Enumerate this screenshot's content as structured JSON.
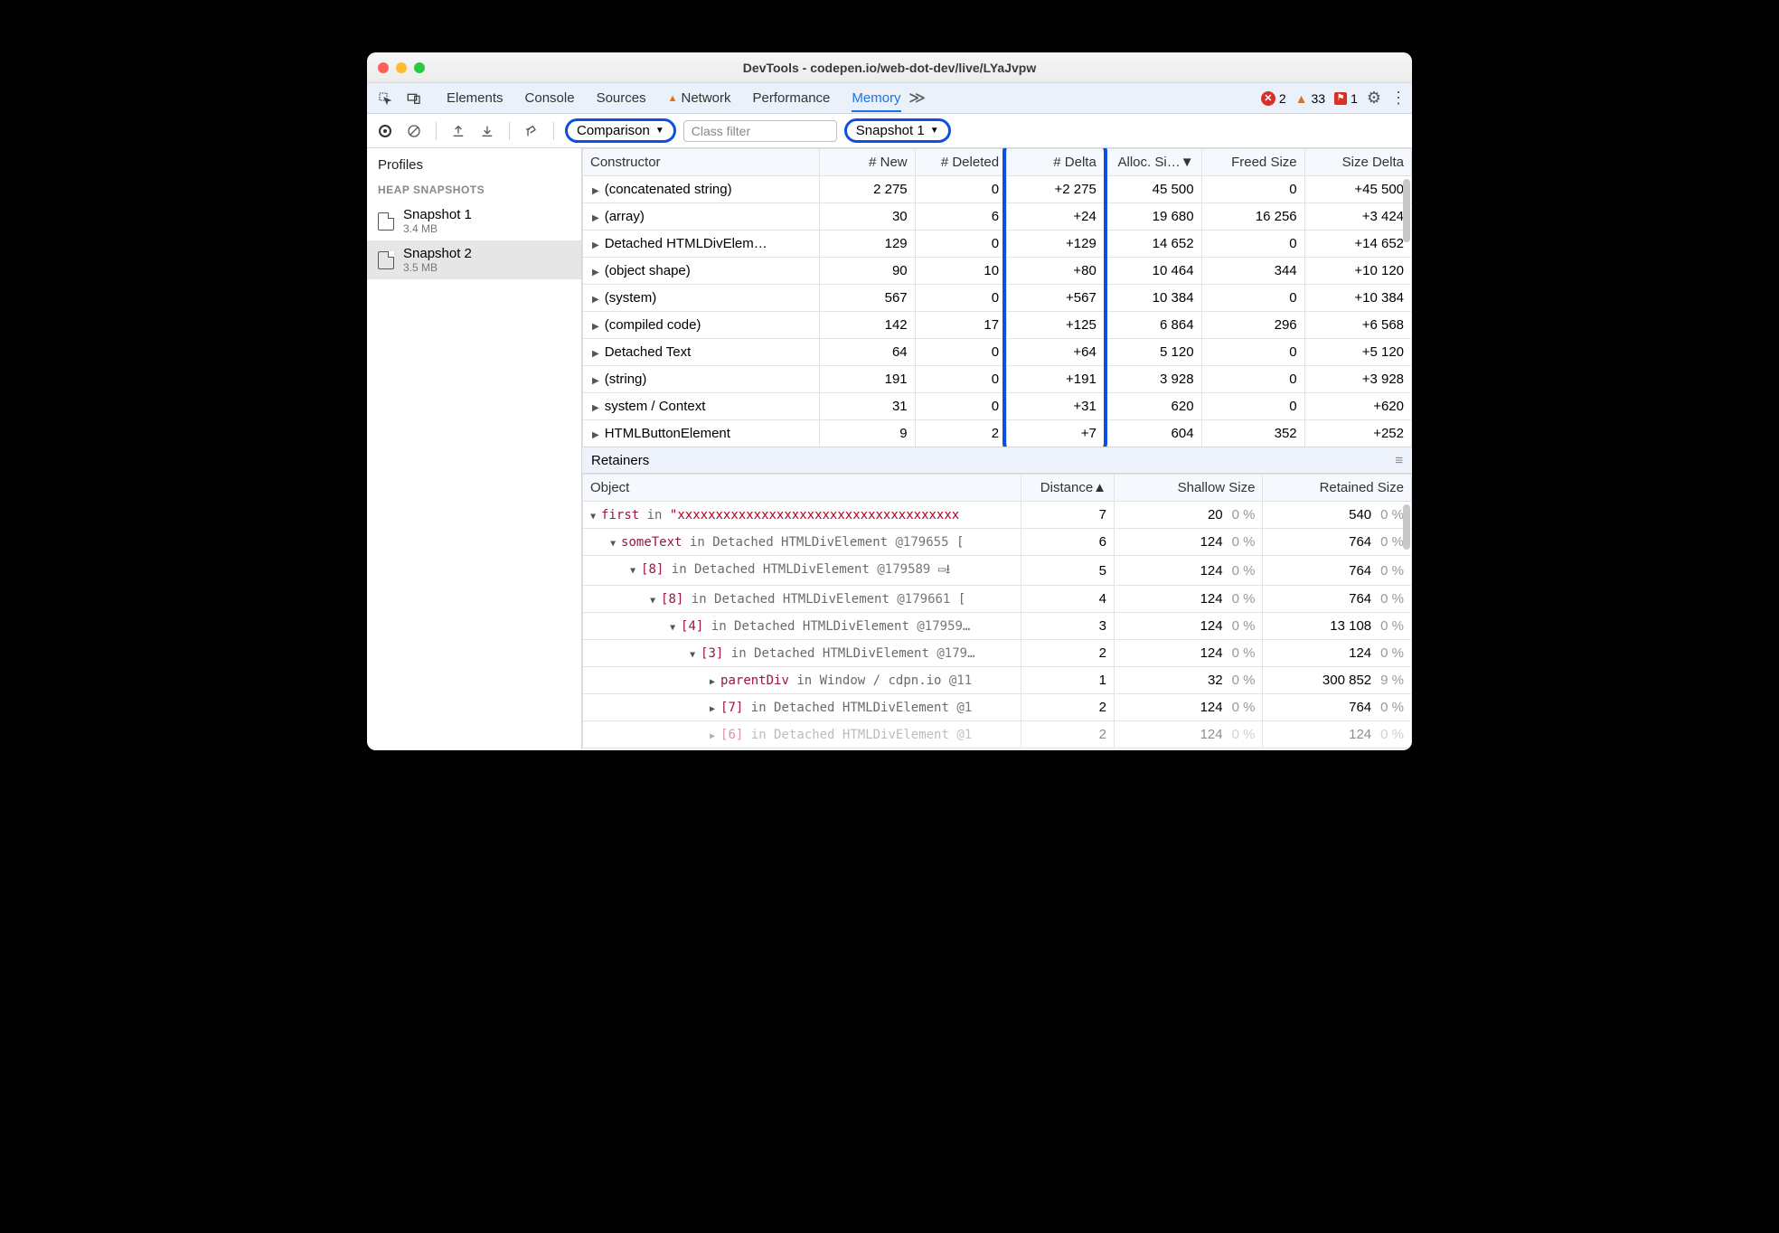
{
  "window": {
    "title": "DevTools - codepen.io/web-dot-dev/live/LYaJvpw"
  },
  "tabs": {
    "items": [
      "Elements",
      "Console",
      "Sources",
      "Network",
      "Performance",
      "Memory"
    ],
    "more": "≫",
    "active": "Memory",
    "warn_tab": "Network"
  },
  "status": {
    "errors": "2",
    "warnings": "33",
    "issues": "1"
  },
  "toolbar": {
    "view_mode": "Comparison",
    "filter_placeholder": "Class filter",
    "baseline": "Snapshot 1"
  },
  "sidebar": {
    "heading": "Profiles",
    "section": "HEAP SNAPSHOTS",
    "snapshots": [
      {
        "name": "Snapshot 1",
        "size": "3.4 MB",
        "selected": false
      },
      {
        "name": "Snapshot 2",
        "size": "3.5 MB",
        "selected": true
      }
    ]
  },
  "grid": {
    "headers": [
      "Constructor",
      "# New",
      "# Deleted",
      "# Delta",
      "Alloc. Si…",
      "Freed Size",
      "Size Delta"
    ],
    "alloc_sorted": true,
    "rows": [
      {
        "c": "(concatenated string)",
        "n": "2 275",
        "d": "0",
        "dl": "+2 275",
        "a": "45 500",
        "f": "0",
        "s": "+45 500"
      },
      {
        "c": "(array)",
        "n": "30",
        "d": "6",
        "dl": "+24",
        "a": "19 680",
        "f": "16 256",
        "s": "+3 424"
      },
      {
        "c": "Detached HTMLDivElem…",
        "n": "129",
        "d": "0",
        "dl": "+129",
        "a": "14 652",
        "f": "0",
        "s": "+14 652"
      },
      {
        "c": "(object shape)",
        "n": "90",
        "d": "10",
        "dl": "+80",
        "a": "10 464",
        "f": "344",
        "s": "+10 120"
      },
      {
        "c": "(system)",
        "n": "567",
        "d": "0",
        "dl": "+567",
        "a": "10 384",
        "f": "0",
        "s": "+10 384"
      },
      {
        "c": "(compiled code)",
        "n": "142",
        "d": "17",
        "dl": "+125",
        "a": "6 864",
        "f": "296",
        "s": "+6 568"
      },
      {
        "c": "Detached Text",
        "n": "64",
        "d": "0",
        "dl": "+64",
        "a": "5 120",
        "f": "0",
        "s": "+5 120"
      },
      {
        "c": "(string)",
        "n": "191",
        "d": "0",
        "dl": "+191",
        "a": "3 928",
        "f": "0",
        "s": "+3 928"
      },
      {
        "c": "system / Context",
        "n": "31",
        "d": "0",
        "dl": "+31",
        "a": "620",
        "f": "0",
        "s": "+620"
      },
      {
        "c": "HTMLButtonElement",
        "n": "9",
        "d": "2",
        "dl": "+7",
        "a": "604",
        "f": "352",
        "s": "+252"
      }
    ]
  },
  "retainers": {
    "title": "Retainers",
    "headers": [
      "Object",
      "Distance",
      "Shallow Size",
      "Retained Size"
    ],
    "dist_sorted_asc": true,
    "rows": [
      {
        "indent": 0,
        "open": true,
        "prop": "first",
        "ctx": "in",
        "str": "\"xxxxxxxxxxxxxxxxxxxxxxxxxxxxxxxxxxxxx",
        "dist": "7",
        "ss": "20",
        "sp": "0 %",
        "rs": "540",
        "rp": "0 %"
      },
      {
        "indent": 1,
        "open": true,
        "prop": "someText",
        "ctx": "in Detached HTMLDivElement",
        "id": "@179655",
        "trail": "[",
        "dist": "6",
        "ss": "124",
        "sp": "0 %",
        "rs": "764",
        "rp": "0 %"
      },
      {
        "indent": 2,
        "open": true,
        "prop": "[8]",
        "ctx": "in Detached HTMLDivElement",
        "id": "@179589",
        "trail": "▭⭳",
        "dist": "5",
        "ss": "124",
        "sp": "0 %",
        "rs": "764",
        "rp": "0 %"
      },
      {
        "indent": 3,
        "open": true,
        "prop": "[8]",
        "ctx": "in Detached HTMLDivElement",
        "id": "@179661",
        "trail": "[",
        "dist": "4",
        "ss": "124",
        "sp": "0 %",
        "rs": "764",
        "rp": "0 %"
      },
      {
        "indent": 4,
        "open": true,
        "prop": "[4]",
        "ctx": "in Detached HTMLDivElement",
        "id": "@17959…",
        "trail": "",
        "dist": "3",
        "ss": "124",
        "sp": "0 %",
        "rs": "13 108",
        "rp": "0 %"
      },
      {
        "indent": 5,
        "open": true,
        "prop": "[3]",
        "ctx": "in Detached HTMLDivElement",
        "id": "@179…",
        "trail": "",
        "dist": "2",
        "ss": "124",
        "sp": "0 %",
        "rs": "124",
        "rp": "0 %"
      },
      {
        "indent": 6,
        "open": false,
        "prop": "parentDiv",
        "ctx": "in Window / cdpn.io",
        "id": "@11",
        "trail": "",
        "dist": "1",
        "ss": "32",
        "sp": "0 %",
        "rs": "300 852",
        "rp": "9 %"
      },
      {
        "indent": 6,
        "open": false,
        "prop": "[7]",
        "ctx": "in Detached HTMLDivElement",
        "id": "@1",
        "trail": "",
        "dist": "2",
        "ss": "124",
        "sp": "0 %",
        "rs": "764",
        "rp": "0 %"
      },
      {
        "indent": 6,
        "open": false,
        "prop": "[6]",
        "ctx": "in Detached HTMLDivElement",
        "id": "@1",
        "trail": "",
        "dist": "2",
        "ss": "124",
        "sp": "0 %",
        "rs": "124",
        "rp": "0 %",
        "dim": true
      }
    ]
  }
}
